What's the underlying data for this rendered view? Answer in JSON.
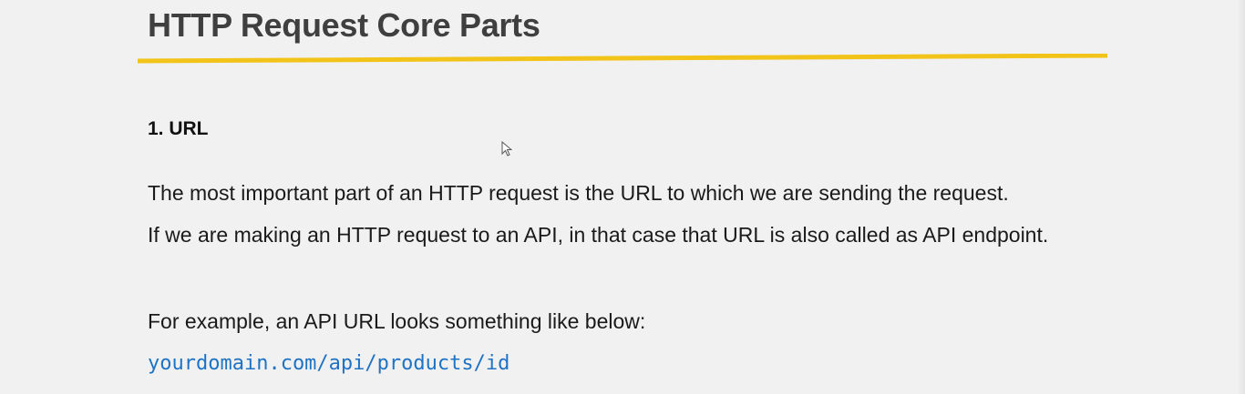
{
  "slide": {
    "title": "HTTP Request Core Parts",
    "accent_color": "#f2c319",
    "section": {
      "heading": "1. URL",
      "paragraph_lines": [
        "The most important part of an HTTP request is the URL to which we are sending the request.",
        "If we are making an HTTP request to an API, in that case that URL is also called as API endpoint."
      ],
      "example_intro": "For example, an API URL looks something like below:",
      "example_url": "yourdomain.com/api/products/id"
    }
  }
}
